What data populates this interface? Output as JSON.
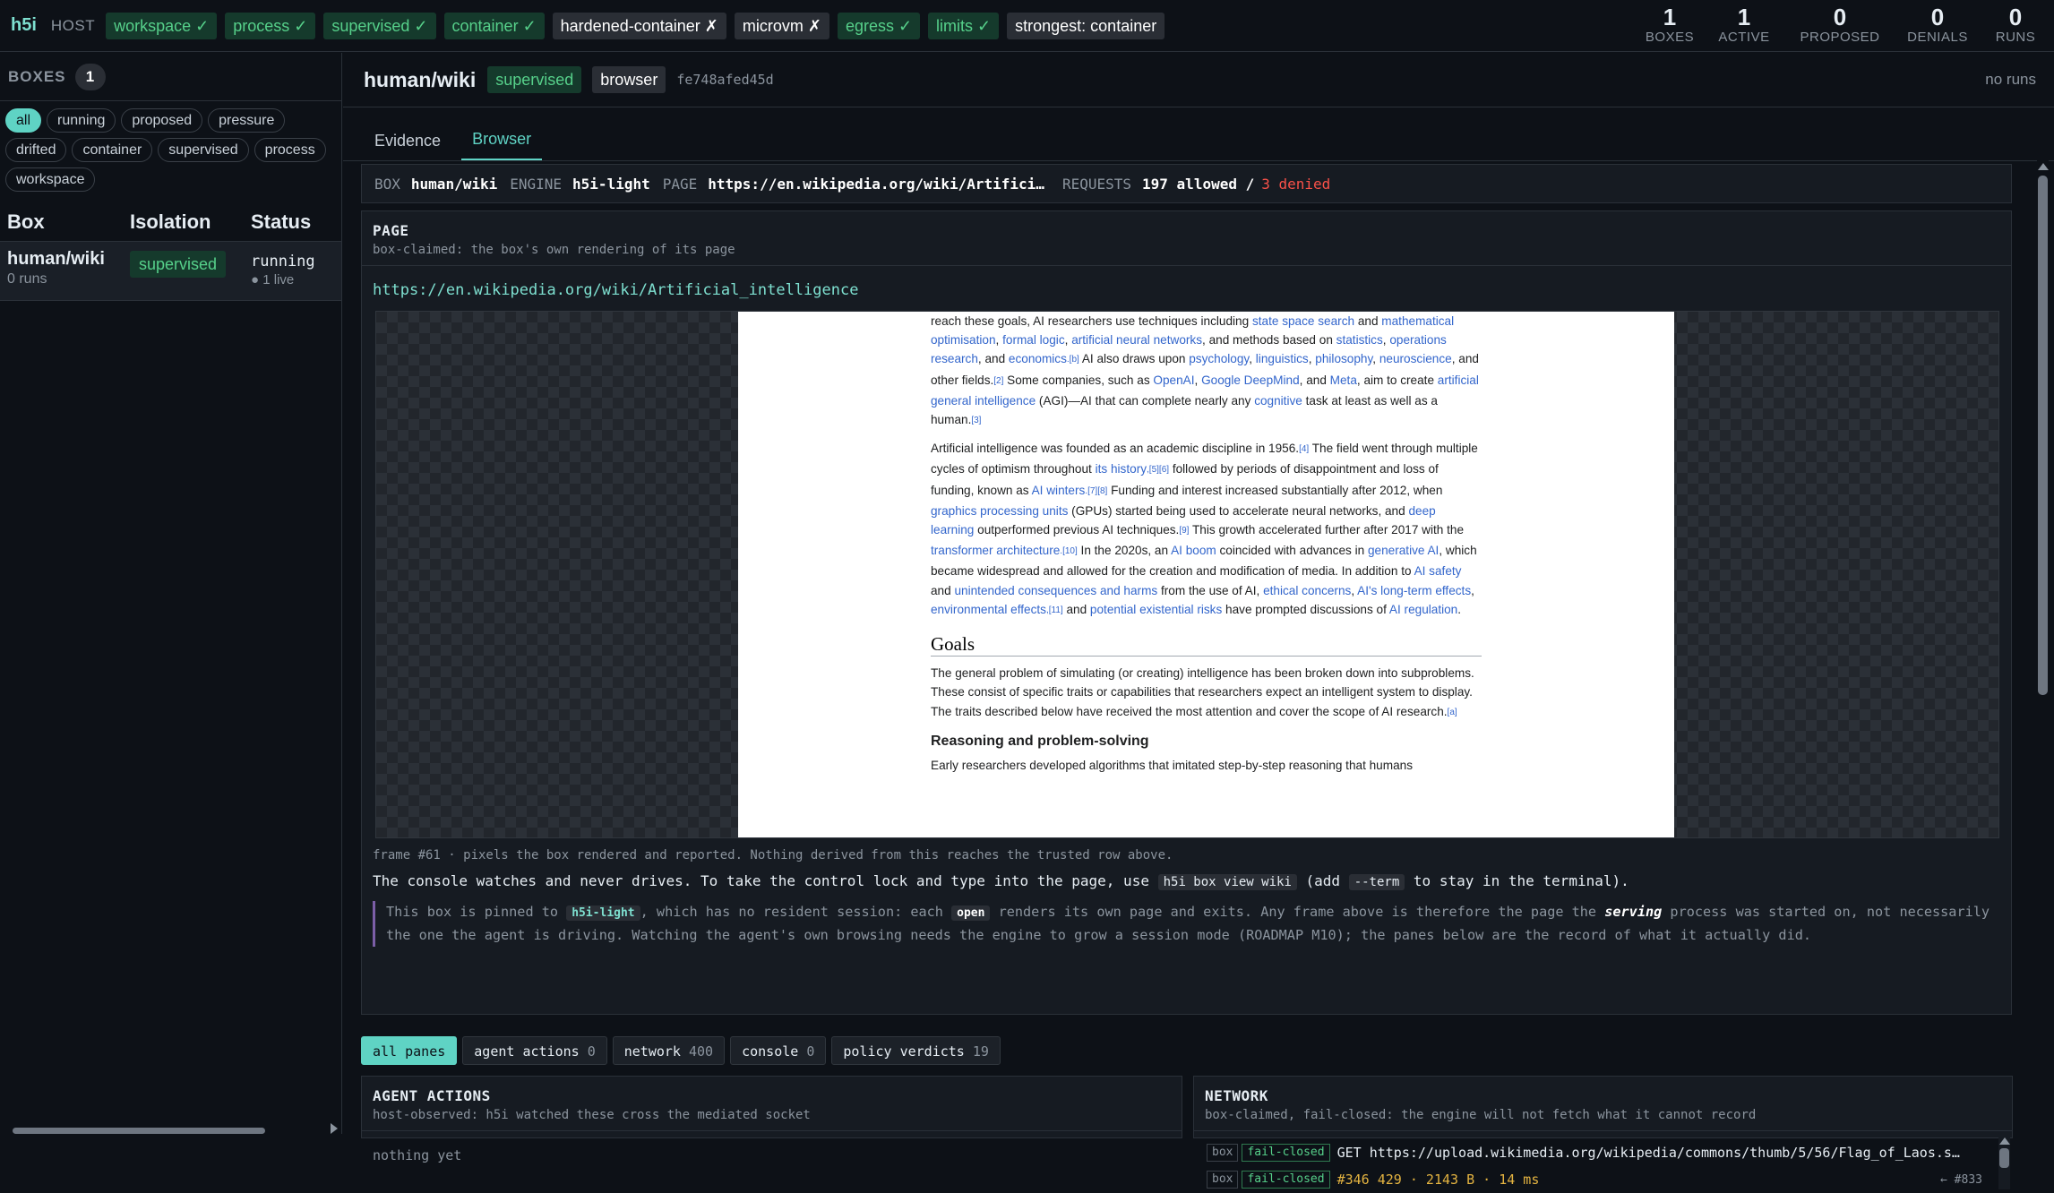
{
  "topbar": {
    "brand": "h5i",
    "host_label": "HOST",
    "capabilities": [
      {
        "label": "workspace ✓",
        "status": "ok"
      },
      {
        "label": "process ✓",
        "status": "ok"
      },
      {
        "label": "supervised ✓",
        "status": "ok"
      },
      {
        "label": "container ✓",
        "status": "ok"
      },
      {
        "label": "hardened-container ✗",
        "status": "no"
      },
      {
        "label": "microvm ✗",
        "status": "no"
      },
      {
        "label": "egress ✓",
        "status": "ok"
      },
      {
        "label": "limits ✓",
        "status": "ok"
      }
    ],
    "strongest": "strongest: container",
    "stats": [
      {
        "value": "1",
        "label": "BOXES"
      },
      {
        "value": "1",
        "label": "ACTIVE"
      },
      {
        "value": "0",
        "label": "PROPOSED"
      },
      {
        "value": "0",
        "label": "DENIALS"
      },
      {
        "value": "0",
        "label": "RUNS"
      }
    ]
  },
  "sidebar": {
    "title": "BOXES",
    "count": "1",
    "filters": [
      "all",
      "running",
      "proposed",
      "pressure",
      "drifted",
      "container",
      "supervised",
      "process",
      "workspace"
    ],
    "active_filter": "all",
    "columns": [
      "Box",
      "Isolation",
      "Status"
    ],
    "rows": [
      {
        "name": "human/wiki",
        "runs": "0 runs",
        "isolation": "supervised",
        "status": "running",
        "live": "● 1 live"
      }
    ]
  },
  "main": {
    "title": "human/wiki",
    "isolation_badge": "supervised",
    "engine_badge": "browser",
    "hash": "fe748afed45d",
    "runs_note": "no runs",
    "tabs": [
      "Evidence",
      "Browser"
    ],
    "active_tab": "Browser",
    "info": {
      "box_key": "BOX",
      "box": "human/wiki",
      "engine_key": "ENGINE",
      "engine": "h5i-light",
      "page_key": "PAGE",
      "page": "https://en.wikipedia.org/wiki/Artifici…",
      "requests_key": "REQUESTS",
      "allowed": "197 allowed /",
      "denied": "3 denied"
    },
    "page_panel": {
      "title": "PAGE",
      "subtitle": "box-claimed: the box's own rendering of its page",
      "url": "https://en.wikipedia.org/wiki/Artificial_intelligence",
      "frame_note": "frame #61 · pixels the box rendered and reported. Nothing derived from this reaches the trusted row above.",
      "console_note_pre": "The console watches and never drives. To take the control lock and type into the page, use",
      "console_cmd": "h5i box view wiki",
      "console_mid": "(add",
      "console_flag": "--term",
      "console_post": "to stay in the terminal).",
      "pin_pre": "This box is pinned to",
      "pin_engine": "h5i-light",
      "pin_mid": ", which has no resident session: each",
      "pin_open": "open",
      "pin_post1": "renders its own page and exits. Any frame above is therefore the page the",
      "pin_serving": "serving",
      "pin_post2": "process was started on, not necessarily",
      "pin_line2": "the one the agent is driving. Watching the agent's own browsing needs the engine to grow a session mode (ROADMAP M10); the panes below are the record of what it actually did."
    },
    "wiki": {
      "p1": [
        {
          "t": "reach these goals, AI researchers use techniques including "
        },
        {
          "t": "state space search",
          "a": true
        },
        {
          "t": " and "
        },
        {
          "t": "mathematical optimisation",
          "a": true
        },
        {
          "t": ", "
        },
        {
          "t": "formal logic",
          "a": true
        },
        {
          "t": ", "
        },
        {
          "t": "artificial neural networks",
          "a": true
        },
        {
          "t": ", and methods based on "
        },
        {
          "t": "statistics",
          "a": true
        },
        {
          "t": ", "
        },
        {
          "t": "operations research",
          "a": true
        },
        {
          "t": ", and "
        },
        {
          "t": "economics",
          "a": true
        },
        {
          "t": ".[b]",
          "s": true
        },
        {
          "t": " AI also draws upon "
        },
        {
          "t": "psychology",
          "a": true
        },
        {
          "t": ", "
        },
        {
          "t": "linguistics",
          "a": true
        },
        {
          "t": ", "
        },
        {
          "t": "philosophy",
          "a": true
        },
        {
          "t": ", "
        },
        {
          "t": "neuroscience",
          "a": true
        },
        {
          "t": ", and other fields."
        },
        {
          "t": "[2]",
          "s": true
        },
        {
          "t": " Some companies, such as "
        },
        {
          "t": "OpenAI",
          "a": true
        },
        {
          "t": ", "
        },
        {
          "t": "Google DeepMind",
          "a": true
        },
        {
          "t": ", and "
        },
        {
          "t": "Meta",
          "a": true
        },
        {
          "t": ", aim to create "
        },
        {
          "t": "artificial general intelligence",
          "a": true
        },
        {
          "t": " (AGI)—AI that can complete nearly any "
        },
        {
          "t": "cognitive",
          "a": true
        },
        {
          "t": " task at least as well as a human."
        },
        {
          "t": "[3]",
          "s": true
        }
      ],
      "p2": [
        {
          "t": "Artificial intelligence was founded as an academic discipline in 1956."
        },
        {
          "t": "[4]",
          "s": true
        },
        {
          "t": " The field went through multiple cycles of optimism throughout "
        },
        {
          "t": "its history",
          "a": true
        },
        {
          "t": ",[5][6]",
          "s": true
        },
        {
          "t": " followed by periods of disappointment and loss of funding, known as "
        },
        {
          "t": "AI winters",
          "a": true
        },
        {
          "t": ".[7][8]",
          "s": true
        },
        {
          "t": " Funding and interest increased substantially after 2012, when "
        },
        {
          "t": "graphics processing units",
          "a": true
        },
        {
          "t": " (GPUs) started being used to accelerate neural networks, and "
        },
        {
          "t": "deep learning",
          "a": true
        },
        {
          "t": " outperformed previous AI techniques."
        },
        {
          "t": "[9]",
          "s": true
        },
        {
          "t": " This growth accelerated further after 2017 with the "
        },
        {
          "t": "transformer architecture",
          "a": true
        },
        {
          "t": ".[10]",
          "s": true
        },
        {
          "t": " In the 2020s, an "
        },
        {
          "t": "AI boom",
          "a": true
        },
        {
          "t": " coincided with advances in "
        },
        {
          "t": "generative AI",
          "a": true
        },
        {
          "t": ", which became widespread and allowed for the creation and modification of media. In addition to "
        },
        {
          "t": "AI safety",
          "a": true
        },
        {
          "t": " and "
        },
        {
          "t": "unintended consequences and harms",
          "a": true
        },
        {
          "t": " from the use of AI, "
        },
        {
          "t": "ethical concerns",
          "a": true
        },
        {
          "t": ", "
        },
        {
          "t": "AI's long-term effects",
          "a": true
        },
        {
          "t": ", "
        },
        {
          "t": "environmental effects",
          "a": true
        },
        {
          "t": ",[11]",
          "s": true
        },
        {
          "t": " and "
        },
        {
          "t": "potential existential risks",
          "a": true
        },
        {
          "t": " have prompted discussions of "
        },
        {
          "t": "AI regulation",
          "a": true
        },
        {
          "t": "."
        }
      ],
      "h_goals": "Goals",
      "p3": [
        {
          "t": "The general problem of simulating (or creating) intelligence has been broken down into subproblems. These consist of specific traits or capabilities that researchers expect an intelligent system to display. The traits described below have received the most attention and cover the scope of AI research."
        },
        {
          "t": "[a]",
          "s": true
        }
      ],
      "h_reasoning": "Reasoning and problem-solving",
      "p4": [
        {
          "t": "Early researchers developed algorithms that imitated step-by-step reasoning that humans"
        }
      ]
    },
    "pane_filters": [
      {
        "label": "all panes",
        "count": "",
        "active": true
      },
      {
        "label": "agent actions",
        "count": "0",
        "active": false
      },
      {
        "label": "network",
        "count": "400",
        "active": false
      },
      {
        "label": "console",
        "count": "0",
        "active": false
      },
      {
        "label": "policy verdicts",
        "count": "19",
        "active": false
      }
    ],
    "agent_panel": {
      "title": "AGENT ACTIONS",
      "subtitle": "host-observed: h5i watched these cross the mediated socket",
      "empty": "nothing yet"
    },
    "network_panel": {
      "title": "NETWORK",
      "subtitle": "box-claimed, fail-closed: the engine will not fetch what it cannot record",
      "rows": [
        {
          "src": "box",
          "verdict": "fail-closed",
          "text": "GET https://upload.wikimedia.org/wikipedia/commons/thumb/5/56/Flag_of_Laos.s…",
          "ref": ""
        },
        {
          "src": "box",
          "verdict": "fail-closed",
          "text": "#346 429 · 2143 B · 14 ms",
          "ref": "← #833"
        }
      ]
    },
    "colors": {
      "accent": "#5fd3c4",
      "ok": "#56d08a",
      "denied": "#f85149",
      "link": "#3366cc"
    }
  }
}
